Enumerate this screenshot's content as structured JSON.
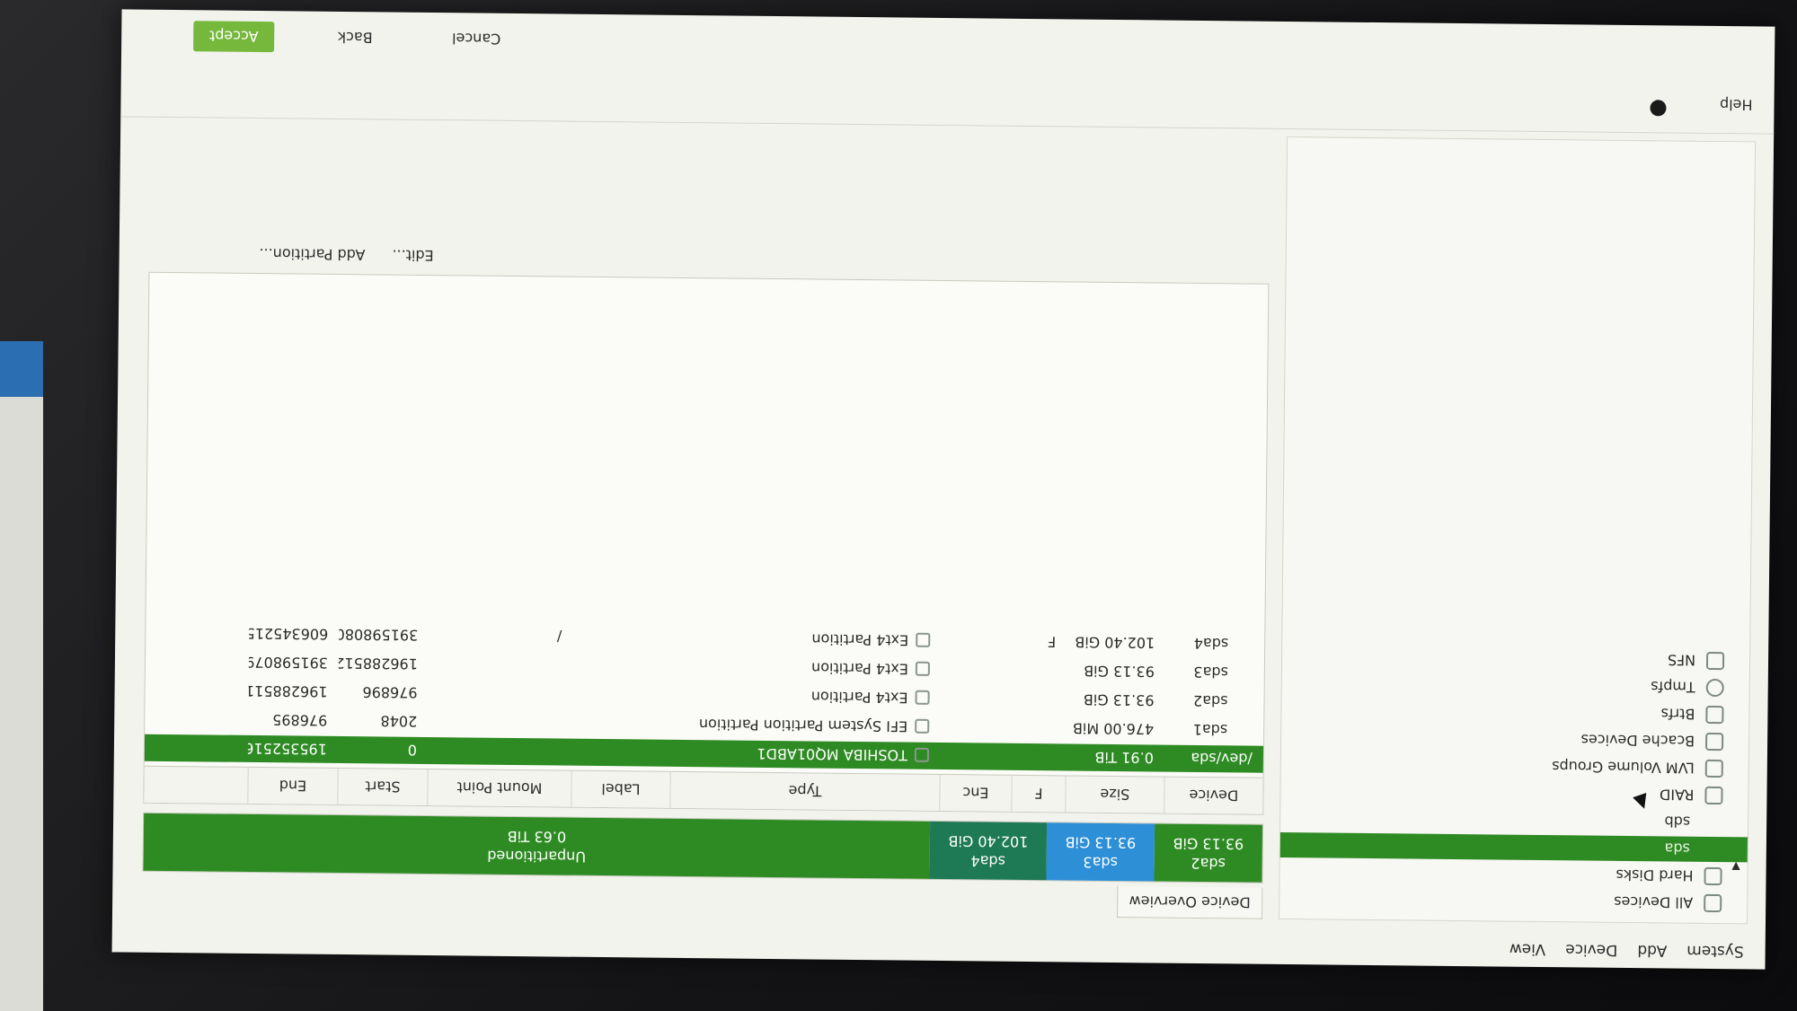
{
  "menu": {
    "system": "System",
    "add": "Add",
    "device": "Device",
    "view": "View"
  },
  "sidebar": {
    "items": [
      {
        "label": "All Devices",
        "icon": "devices-icon"
      },
      {
        "label": "Hard Disks",
        "icon": "harddisk-icon"
      },
      {
        "label": "sda",
        "icon": ""
      },
      {
        "label": "sdb",
        "icon": ""
      },
      {
        "label": "RAID",
        "icon": "raid-icon"
      },
      {
        "label": "LVM Volume Groups",
        "icon": "lvm-icon"
      },
      {
        "label": "Bcache Devices",
        "icon": "bcache-icon"
      },
      {
        "label": "Btrfs",
        "icon": "btrfs-icon"
      },
      {
        "label": "Tmpfs",
        "icon": "tmpfs-icon"
      },
      {
        "label": "NFS",
        "icon": "nfs-icon"
      }
    ]
  },
  "overview_tab": "Device Overview",
  "diskbar": {
    "segments": [
      {
        "name": "sda2",
        "size": "93.13 GiB",
        "color": "#2e8b23"
      },
      {
        "name": "sda3",
        "size": "93.13 GiB",
        "color": "#2d8fd6"
      },
      {
        "name": "sda4",
        "size": "102.40 GiB",
        "color": "#1e7a55"
      },
      {
        "name": "Unpartitioned",
        "size": "0.63 TiB",
        "color": "#2e8b23"
      }
    ]
  },
  "table": {
    "headers": [
      "Device",
      "Size",
      "F",
      "Enc",
      "Type",
      "Label",
      "Mount Point",
      "Start",
      "End"
    ],
    "rows": [
      {
        "device": "/dev/sda",
        "size": "0.91 TiB",
        "f": "",
        "enc": "",
        "type": "TOSHIBA MQ01ABD1",
        "label": "",
        "mount": "",
        "start": "0",
        "end": "1953525167",
        "disk": true
      },
      {
        "device": "sda1",
        "size": "476.00 MiB",
        "f": "",
        "enc": "",
        "type": "EFI System Partition Partition",
        "label": "",
        "mount": "",
        "start": "2048",
        "end": "976895",
        "disk": false
      },
      {
        "device": "sda2",
        "size": "93.13 GiB",
        "f": "",
        "enc": "",
        "type": "Ext4 Partition",
        "label": "",
        "mount": "",
        "start": "976896",
        "end": "196288511",
        "disk": false
      },
      {
        "device": "sda3",
        "size": "93.13 GiB",
        "f": "",
        "enc": "",
        "type": "Ext4 Partition",
        "label": "",
        "mount": "",
        "start": "196288512",
        "end": "391598079",
        "disk": false
      },
      {
        "device": "sda4",
        "size": "102.40 GiB",
        "f": "F",
        "enc": "",
        "type": "Ext4 Partition",
        "label": "",
        "mount": "/",
        "start": "391598080",
        "end": "606345215",
        "disk": false
      }
    ]
  },
  "actions": {
    "edit": "Edit...",
    "add_partition": "Add Partition..."
  },
  "status": {
    "help": "Help"
  },
  "buttons": {
    "accept": "Accept",
    "back": "Back",
    "cancel": "Cancel"
  }
}
